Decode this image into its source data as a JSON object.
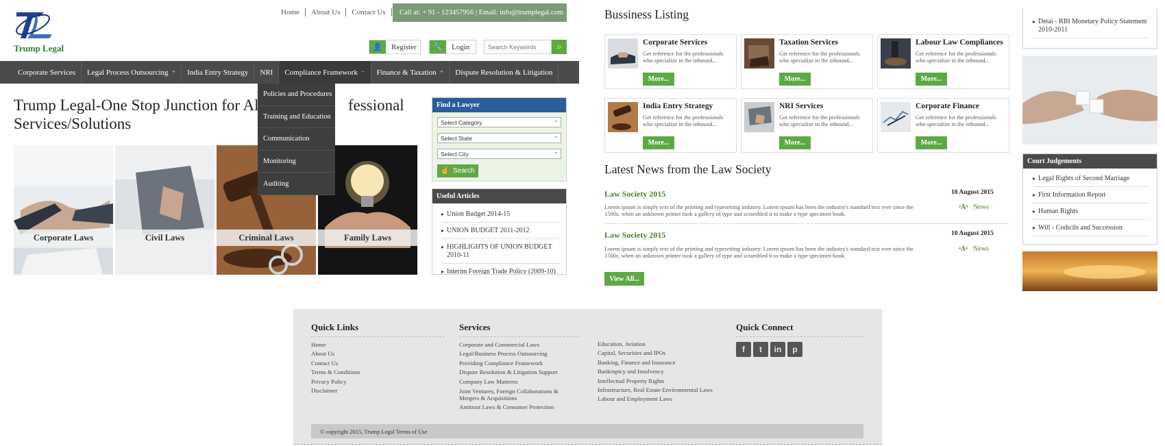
{
  "brand": {
    "name": "Trump Legal"
  },
  "top_links": [
    "Home",
    "About Us",
    "Contact Us"
  ],
  "contact_bar": "Call at: + 91 - 123457956  |  Email: info@trumplegal.com",
  "auth": {
    "register": "Register",
    "login": "Login"
  },
  "search": {
    "placeholder": "Search Keywords"
  },
  "nav": {
    "items": [
      {
        "label": "Corporate Services",
        "plus": ""
      },
      {
        "label": "Legal Process Outsourcing",
        "plus": "+"
      },
      {
        "label": "India Entry Strategy",
        "plus": ""
      },
      {
        "label": "NRI",
        "plus": ""
      },
      {
        "label": "Compliance Framework",
        "plus": "−"
      },
      {
        "label": "Finance & Taxation",
        "plus": "+"
      },
      {
        "label": "Dispute Resolution & Litigation",
        "plus": ""
      }
    ],
    "dropdown": [
      "Policies and Procedures",
      "Training and Education",
      "Communication",
      "Monitoring",
      "Auditing"
    ]
  },
  "hero": {
    "title_a": "Trump Legal-One Stop Junction for All",
    "title_b": "fessional",
    "title_c": "Services/Solutions"
  },
  "tiles": [
    "Corporate Laws",
    "Civil Laws",
    "Criminal Laws",
    "Family Laws"
  ],
  "find_lawyer": {
    "title": "Find a Lawyer",
    "category": "Select Category",
    "state": "Select State",
    "city": "Select City",
    "button": "Search"
  },
  "useful_articles": {
    "title": "Useful Articles",
    "items": [
      "Union Budget 2014-15",
      "UNION BUDGET 2011-2012",
      "HIGHLIGHTS OF UNION BUDGET 2010-11",
      "Interim Foreign Trade Policy (2009-10)"
    ]
  },
  "business_listing": {
    "title": "Bussiness Listing",
    "more": "More...",
    "desc": "Get reference for the professionals who specialize in the inbound...",
    "cards": [
      "Corporate Services",
      "Taxation Services",
      "Labour Law Compliances",
      "India Entry Strategy",
      "NRI Services",
      "Corporate Finance"
    ]
  },
  "news": {
    "title": "Latest News from the Law Society",
    "items": [
      {
        "title": "Law Society 2015",
        "date": "10 August 2015",
        "body": "Lorem ipsum is simply text of the printing and typesetting industry. Lorem ipsum has been the industry's standard text ever since the 1500s, when an unknown printer took a gallery of type and scrambled it to make a type specimen book.",
        "tag": "News"
      },
      {
        "title": "Law Society 2015",
        "date": "10 August 2015",
        "body": "Lorem ipsum is simply text of the printing and typesetting industry. Lorem ipsum has been the industry's standard text ever since the 1500s, when an unknown printer took a gallery of type and scrambled it to make a type specimen book.",
        "tag": "News"
      }
    ],
    "view_all": "View All..."
  },
  "sidebar": {
    "top_item": "Detai - RBI Monetary Policy Statement 2010-2011",
    "judgements_title": "Court Judgements",
    "judgements": [
      "Legal Rights of Second Marriage",
      "First Information Report",
      "Human Rights",
      "Will - Codicils and Succession"
    ]
  },
  "footer": {
    "quick_links_title": "Quick Links",
    "quick_links": [
      "Home",
      "About Us",
      "Contact Us",
      "Terms & Conditions",
      "Privacy Policy",
      "Disclaimer"
    ],
    "services_title": "Services",
    "services_a": [
      "Corporate and Commercial Laws",
      "Legal/Business Process Outsourcing",
      "Providing Compliance Framework",
      "Dispute Resolution & Litigation Support",
      "Company Law Matterns",
      "Joint Ventures, Foreign Collaborations & Mergers & Acquisitions",
      "Antitrust Laws & Consumer Protection"
    ],
    "services_b": [
      "Education, Aviation",
      "Capital, Securities and IPOs",
      "Banking, Finance and Insurance",
      "Bankruptcy and Insolvency",
      "Intellectual Property Rights",
      "Infrastructure, Real Estate Environmental Laws",
      "Labour and Employment Laws"
    ],
    "quick_connect_title": "Quick Connect",
    "copyright": "© copyright 2015, Trump Legal Terms of Use"
  },
  "colors": {
    "accent_green": "#5ea845",
    "nav_dark": "#4a4a4a",
    "finder_blue": "#2a5d9c"
  }
}
